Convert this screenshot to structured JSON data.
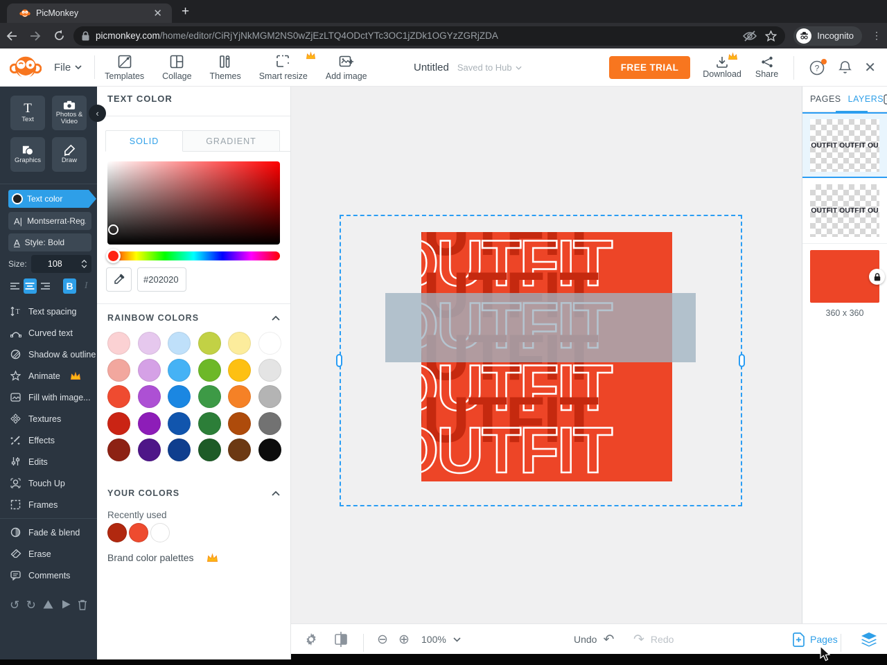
{
  "browser": {
    "tab_title": "PicMonkey",
    "url_domain": "picmonkey.com",
    "url_path": "/home/editor/CiRjYjNkMGM2NS0wZjEzLTQ4ODctYTc3OC1jZDk1OGYzZGRjZDA",
    "incognito_label": "Incognito"
  },
  "appbar": {
    "file_label": "File",
    "nav_items": [
      {
        "label": "Templates"
      },
      {
        "label": "Collage"
      },
      {
        "label": "Themes"
      },
      {
        "label": "Smart resize"
      },
      {
        "label": "Add image"
      }
    ],
    "doc_title": "Untitled",
    "saved_status": "Saved to Hub",
    "free_trial_label": "FREE TRIAL",
    "download_label": "Download",
    "share_label": "Share"
  },
  "toolrail": {
    "tools": [
      {
        "label": "Text"
      },
      {
        "label": "Photos & Video"
      },
      {
        "label": "Graphics"
      },
      {
        "label": "Draw"
      }
    ],
    "text_color_label": "Text color",
    "font_label": "Montserrat-Reg...",
    "style_label": "Style: Bold",
    "size_label": "Size:",
    "size_value": "108",
    "bold_label": "B",
    "italic_label": "I",
    "menu": [
      {
        "label": "Text spacing"
      },
      {
        "label": "Curved text"
      },
      {
        "label": "Shadow & outline"
      },
      {
        "label": "Animate"
      },
      {
        "label": "Fill with image..."
      },
      {
        "label": "Textures"
      },
      {
        "label": "Effects"
      },
      {
        "label": "Edits"
      },
      {
        "label": "Touch Up"
      },
      {
        "label": "Frames"
      }
    ],
    "menu_secondary": [
      {
        "label": "Fade & blend"
      },
      {
        "label": "Erase"
      },
      {
        "label": "Comments"
      }
    ]
  },
  "color_panel": {
    "title": "TEXT COLOR",
    "tab_solid": "SOLID",
    "tab_gradient": "GRADIENT",
    "hex_value": "#202020",
    "rainbow_title": "RAINBOW COLORS",
    "rainbow_colors": [
      "#fbd1d3",
      "#e6c8ee",
      "#bfe0fa",
      "#c2d145",
      "#fcec9c",
      "#ffffff",
      "#f2a79e",
      "#d5a1e6",
      "#45b2f5",
      "#6db828",
      "#fdc013",
      "#e4e4e4",
      "#ef4b30",
      "#ad50d4",
      "#1b87e2",
      "#3d9a46",
      "#f58126",
      "#b4b4b4",
      "#ca2414",
      "#8d1db8",
      "#1155ad",
      "#2c7e38",
      "#ae4b0b",
      "#727272",
      "#8d2214",
      "#4e1688",
      "#0f3e8e",
      "#1e5b27",
      "#6c3913",
      "#0c0c0c"
    ],
    "your_colors_title": "YOUR COLORS",
    "recently_used_label": "Recently used",
    "recent_colors": [
      "#b1280f",
      "#ee4b2f",
      "#ffffff"
    ],
    "brand_palettes_label": "Brand color palettes"
  },
  "canvas": {
    "artwork_text": "OUTFIT",
    "artwork_bg": "#ed4527",
    "artwork_shadow_color": "#c5290f"
  },
  "layers_panel": {
    "tab_pages": "PAGES",
    "tab_layers": "LAYERS",
    "layer_thumb_text": "OUTFIT OUTFIT OU",
    "background_size_label": "360 x 360"
  },
  "bottombar": {
    "zoom_value": "100%",
    "undo_label": "Undo",
    "redo_label": "Redo",
    "pages_label": "Pages"
  },
  "theme": {
    "accent_blue": "#2e9fe8",
    "brand_orange": "#f8761f"
  }
}
